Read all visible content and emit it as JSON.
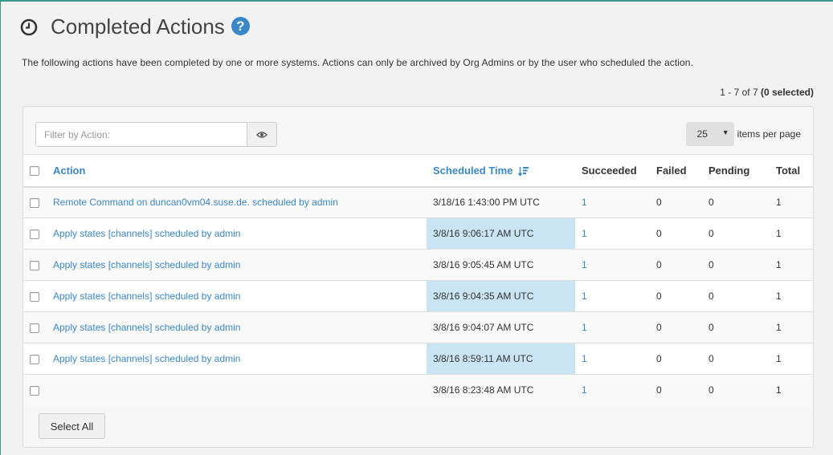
{
  "header": {
    "title": "Completed Actions",
    "help_icon": "?"
  },
  "description": "The following actions have been completed by one or more systems. Actions can only be archived by Org Admins or by the user who scheduled the action.",
  "pagination": {
    "range": "1 - 7 of 7",
    "selected": "(0 selected)"
  },
  "filter": {
    "placeholder": "Filter by Action:"
  },
  "per_page": {
    "value": "25",
    "label": "items per page"
  },
  "table": {
    "columns": {
      "action": "Action",
      "scheduled_time": "Scheduled Time",
      "succeeded": "Succeeded",
      "failed": "Failed",
      "pending": "Pending",
      "total": "Total"
    },
    "rows": [
      {
        "action": "Remote Command on duncan0vm04.suse.de. scheduled by admin",
        "time": "3/18/16 1:43:00 PM UTC",
        "succeeded": "1",
        "failed": "0",
        "pending": "0",
        "total": "1",
        "highlight": false
      },
      {
        "action": "Apply states [channels] scheduled by admin",
        "time": "3/8/16 9:06:17 AM UTC",
        "succeeded": "1",
        "failed": "0",
        "pending": "0",
        "total": "1",
        "highlight": true
      },
      {
        "action": "Apply states [channels] scheduled by admin",
        "time": "3/8/16 9:05:45 AM UTC",
        "succeeded": "1",
        "failed": "0",
        "pending": "0",
        "total": "1",
        "highlight": false
      },
      {
        "action": "Apply states [channels] scheduled by admin",
        "time": "3/8/16 9:04:35 AM UTC",
        "succeeded": "1",
        "failed": "0",
        "pending": "0",
        "total": "1",
        "highlight": true
      },
      {
        "action": "Apply states [channels] scheduled by admin",
        "time": "3/8/16 9:04:07 AM UTC",
        "succeeded": "1",
        "failed": "0",
        "pending": "0",
        "total": "1",
        "highlight": false
      },
      {
        "action": "Apply states [channels] scheduled by admin",
        "time": "3/8/16 8:59:11 AM UTC",
        "succeeded": "1",
        "failed": "0",
        "pending": "0",
        "total": "1",
        "highlight": true
      },
      {
        "action": "",
        "time": "3/8/16 8:23:48 AM UTC",
        "succeeded": "1",
        "failed": "0",
        "pending": "0",
        "total": "1",
        "highlight": false
      }
    ]
  },
  "footer": {
    "select_all_label": "Select All"
  },
  "colors": {
    "link": "#3a87c8",
    "highlight": "#c9e4f2",
    "accent_border": "#3c9a8a"
  },
  "icons": {
    "title": "clock-icon",
    "help": "question-circle-icon",
    "filter_toggle": "eye-icon",
    "sort": "sort-descending-icon",
    "dropdown": "caret-down-icon"
  }
}
